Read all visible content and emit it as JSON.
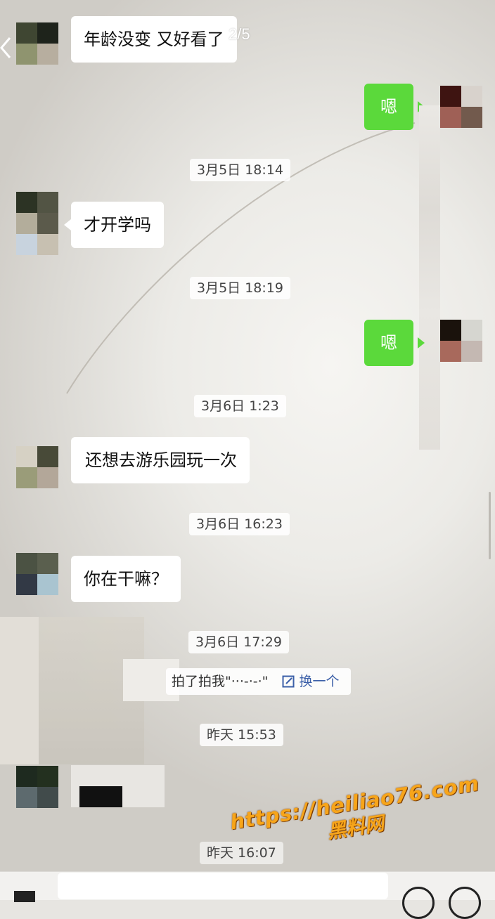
{
  "viewer": {
    "page_counter": "2/5"
  },
  "messages": [
    {
      "id": "m1",
      "side": "left",
      "text": "年龄没变 又好看了"
    },
    {
      "id": "m2",
      "side": "right",
      "text": "嗯"
    },
    {
      "id": "m3",
      "side": "left",
      "text": "才开学吗"
    },
    {
      "id": "m4",
      "side": "right",
      "text": "嗯"
    },
    {
      "id": "m5",
      "side": "left",
      "text": "还想去游乐园玩一次"
    },
    {
      "id": "m6",
      "side": "left",
      "text": "你在干嘛？"
    }
  ],
  "timestamps": [
    "3月5日 18:14",
    "3月5日 18:19",
    "3月6日 1:23",
    "3月6日 16:23",
    "3月6日 17:29",
    "昨天 15:53",
    "昨天 16:07"
  ],
  "system": {
    "pat_text": "拍了拍我",
    "pat_suffix": "\"···-·-·\"",
    "change_label": "换一个"
  },
  "watermark": {
    "url": "https://heiliao76.com",
    "name": "黑料网"
  },
  "colors": {
    "my_bubble": "#5bd93b",
    "their_bubble": "#ffffff",
    "watermark": "#f7a51a"
  },
  "icons": {
    "back": "chevron-left-icon",
    "edit": "edit-icon",
    "emoji": "emoji-icon",
    "more": "plus-icon",
    "voice": "voice-icon"
  }
}
